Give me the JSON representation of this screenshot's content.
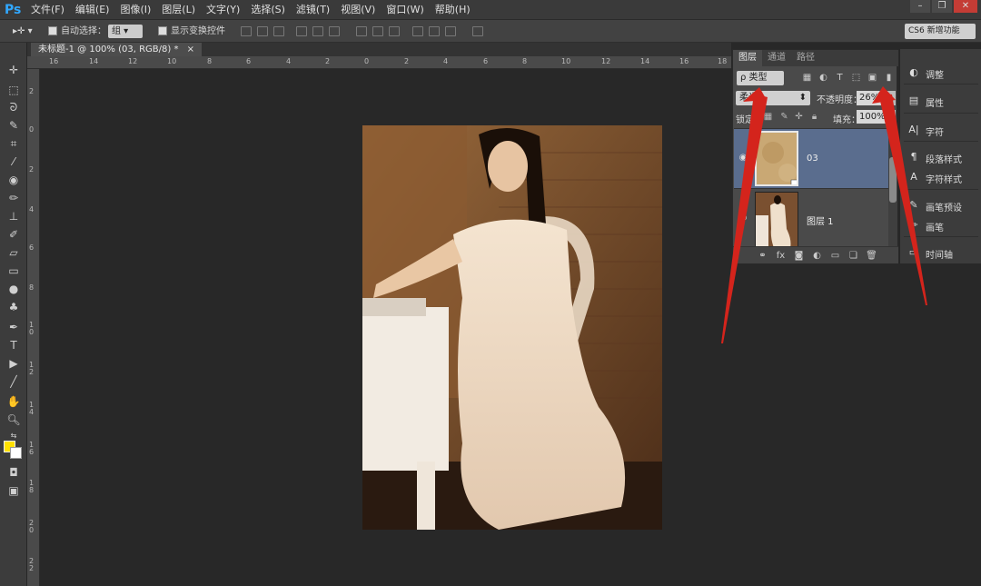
{
  "app": {
    "logo": "Ps"
  },
  "menu": [
    "文件(F)",
    "编辑(E)",
    "图像(I)",
    "图层(L)",
    "文字(Y)",
    "选择(S)",
    "滤镜(T)",
    "视图(V)",
    "窗口(W)",
    "帮助(H)"
  ],
  "options": {
    "auto_select_label": "自动选择：",
    "auto_select_value": "组",
    "show_transform_label": "显示变换控件",
    "workspace": "CS6 新增功能"
  },
  "document": {
    "tab_title": "未标题-1 @ 100% (03, RGB/8) *",
    "tab_close": "×"
  },
  "ruler": {
    "top_ticks": [
      "16",
      "14",
      "12",
      "10",
      "8",
      "6",
      "4",
      "2",
      "0",
      "2",
      "4",
      "6",
      "8",
      "10",
      "12",
      "14",
      "16",
      "18"
    ],
    "left_ticks": [
      "2",
      "0",
      "2",
      "4",
      "6",
      "8",
      "1\n0",
      "1\n2",
      "1\n4",
      "1\n6",
      "1\n8",
      "2\n0",
      "2\n2"
    ]
  },
  "layers_panel": {
    "tabs": [
      "图层",
      "通道",
      "路径"
    ],
    "filter_label": "ρ 类型",
    "blend_mode": "柔光",
    "opacity_label": "不透明度：",
    "opacity_value": "26%",
    "lock_label": "锁定：",
    "fill_label": "填充：",
    "fill_value": "100%",
    "layers": [
      {
        "name": "03",
        "selected": true
      },
      {
        "name": "图层 1",
        "selected": false
      }
    ]
  },
  "side_panel": {
    "items": [
      "调整",
      "属性",
      "字符",
      "段落样式",
      "字符样式",
      "画笔预设",
      "画笔",
      "时间轴"
    ]
  },
  "colors": {
    "foreground": "#ffe100",
    "background": "#ffffff",
    "annotation": "#d4241c"
  }
}
